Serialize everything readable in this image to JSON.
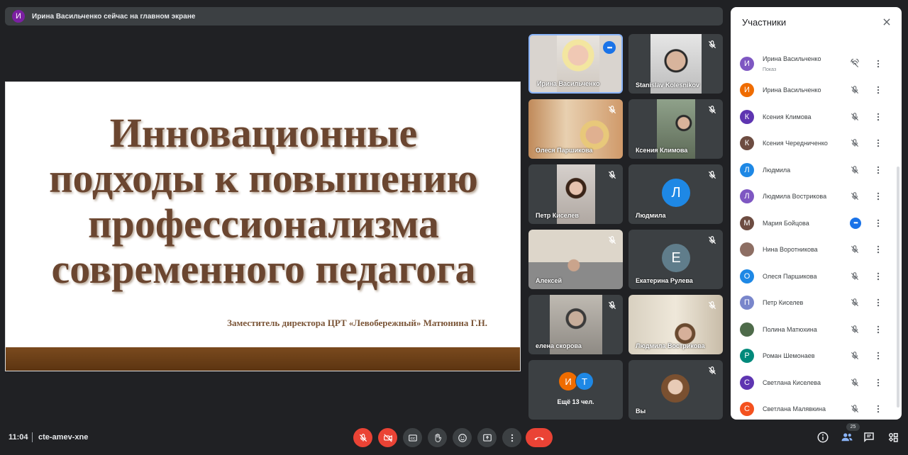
{
  "banner": {
    "avatar_letter": "И",
    "text": "Ирина Васильченко сейчас на главном экране"
  },
  "slide": {
    "title_lines": [
      "Инновационные",
      "подходы к повышению",
      "профессионализма",
      "современного педагога"
    ],
    "subtitle": "Заместитель директора ЦРТ «Левобережный» Матюнина Г.Н."
  },
  "tiles": [
    {
      "name": "Ирина Васильченко"
    },
    {
      "name": "Stanislav Kolesnikov"
    },
    {
      "name": "Олеся Паршикова"
    },
    {
      "name": "Ксения Климова"
    },
    {
      "name": "Петр Киселев"
    },
    {
      "name": "Людмила",
      "letter": "Л"
    },
    {
      "name": "Алексей"
    },
    {
      "name": "Екатерина Рулева",
      "letter": "Е"
    },
    {
      "name": "елена скорова"
    },
    {
      "name": "Людмила Вострикова"
    },
    {
      "name": "Ещё 13 чел.",
      "letters": [
        "И",
        "Т"
      ]
    },
    {
      "name": "Вы"
    }
  ],
  "panel": {
    "title": "Участники",
    "participants": [
      {
        "letter": "И",
        "name": "Ирина Васильченко",
        "sub": "Показ",
        "color": "#7e57c2"
      },
      {
        "letter": "И",
        "name": "Ирина Васильченко",
        "color": "#ef6c00"
      },
      {
        "letter": "К",
        "name": "Ксения Климова",
        "color": "#5e35b1"
      },
      {
        "letter": "К",
        "name": "Ксения Чередниченко",
        "color": "#6d4c41"
      },
      {
        "letter": "Л",
        "name": "Людмила",
        "color": "#1e88e5"
      },
      {
        "letter": "Л",
        "name": "Людмила Вострикова",
        "color": "#7e57c2"
      },
      {
        "letter": "М",
        "name": "Мария Бойцова",
        "color": "#6d4c41"
      },
      {
        "letter": "",
        "name": "Нина Воротникова",
        "color": "#8d6e63"
      },
      {
        "letter": "О",
        "name": "Олеся Паршикова",
        "color": "#1e88e5"
      },
      {
        "letter": "П",
        "name": "Петр Киселев",
        "color": "#7986cb"
      },
      {
        "letter": "",
        "name": "Полина Матюхина",
        "color": "#4e6b4a"
      },
      {
        "letter": "Р",
        "name": "Роман Шемонаев",
        "color": "#00897b"
      },
      {
        "letter": "С",
        "name": "Светлана Киселева",
        "color": "#5e35b1"
      },
      {
        "letter": "С",
        "name": "Светлана Малявкина",
        "color": "#f4511e"
      }
    ]
  },
  "bottom": {
    "time": "11:04",
    "meeting_code": "cte-amev-xne",
    "participant_count": "25"
  }
}
